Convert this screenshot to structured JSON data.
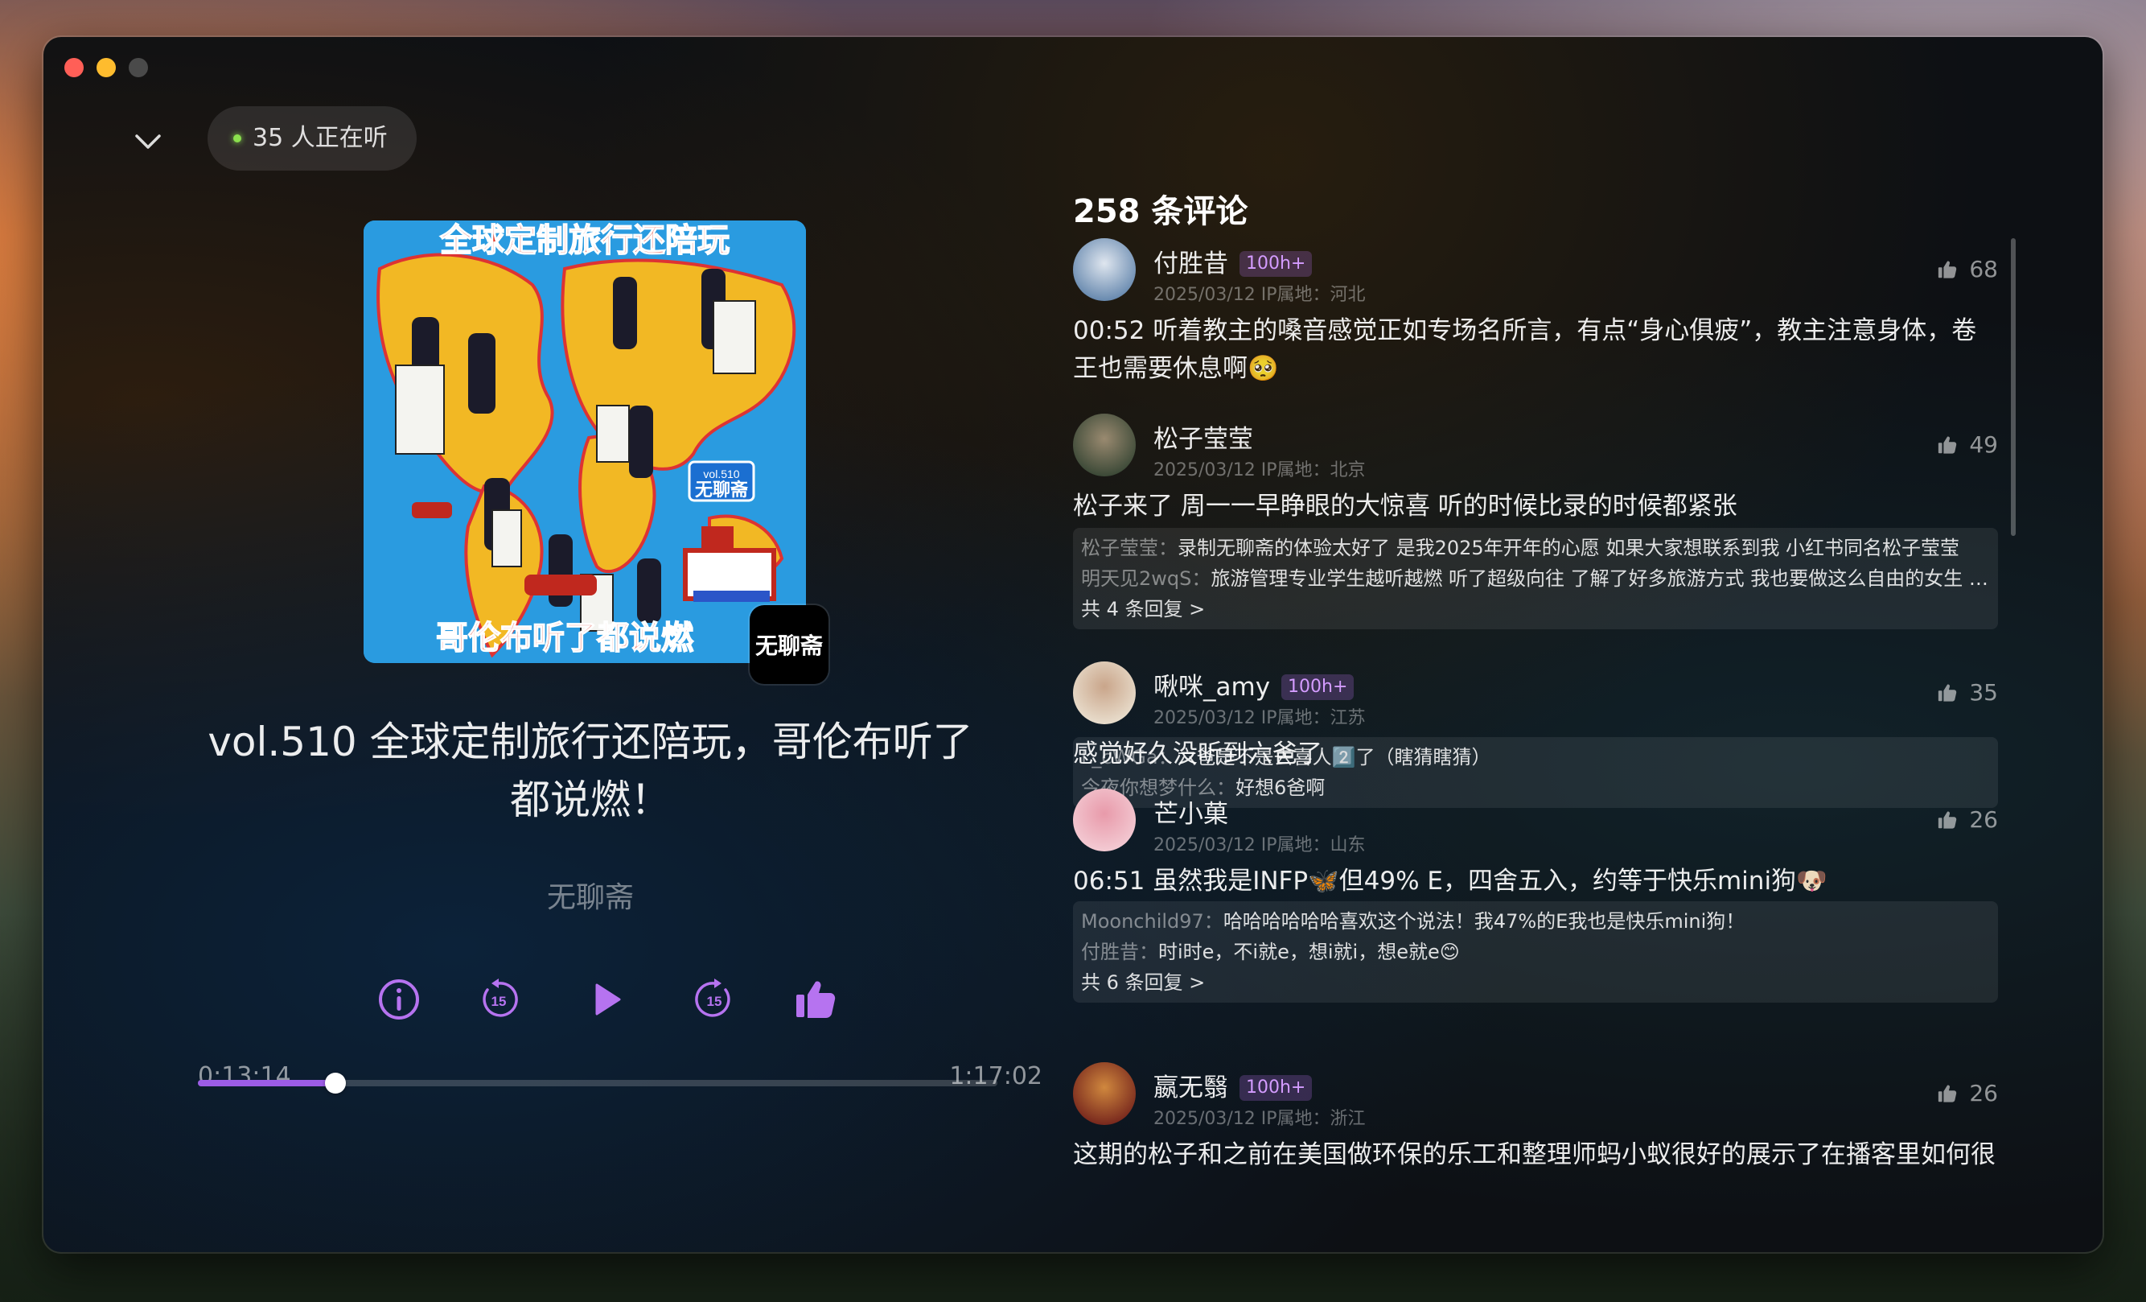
{
  "window": {
    "controls": [
      "close",
      "minimize",
      "maximize"
    ]
  },
  "header": {
    "collapse_icon": "chevron-down-icon",
    "listeners_text": "35 人正在听",
    "live_color": "#8be04e"
  },
  "cover": {
    "headline_top": "全球定制旅行还陪玩",
    "headline_bottom": "哥伦布听了都说燃",
    "volume_tag": "vol.510",
    "show_logo_text": "无聊斋",
    "badge_text": "无聊斋"
  },
  "episode": {
    "title": "vol.510 全球定制旅行还陪玩，哥伦布听了都说燃！",
    "author": "无聊斋"
  },
  "player": {
    "buttons": [
      "info-icon",
      "rewind-15-icon",
      "play-icon",
      "forward-15-icon",
      "thumbs-up-icon"
    ],
    "rewind_seconds": "15",
    "forward_seconds": "15",
    "current_time": "0:13:14",
    "total_time": "1:17:02",
    "progress": 0.1718,
    "accent": "#9c5ce6"
  },
  "comments": {
    "title": "258 条评论",
    "items": [
      {
        "name": "付胜昔",
        "badge": "100h+",
        "meta": "2025/03/12 IP属地：河北",
        "likes": "68",
        "text": "00:52 听着教主的嗓音感觉正如专场名所言，有点“身心俱疲”，教主注意身体，卷王也需要休息啊🥺",
        "replies": [],
        "more": ""
      },
      {
        "name": "松子莹莹",
        "badge": "",
        "meta": "2025/03/12 IP属地：北京",
        "likes": "49",
        "text": "松子来了 周一一早睁眼的大惊喜 听的时候比录的时候都紧张",
        "replies": [
          {
            "user": "松子莹莹：",
            "text": "录制无聊斋的体验太好了 是我2025年开年的心愿 如果大家想联系到我 小红书同名松子莹莹"
          },
          {
            "user": "明天见2wqS：",
            "text": "旅游管理专业学生越听越燃 听了超级向往 了解了好多旅游方式 我也要做这么自由的女生 想要做这样的工作！"
          }
        ],
        "more": "共 4 条回复 >"
      },
      {
        "name": "啾咪_amy",
        "badge": "100h+",
        "meta": "2025/03/12 IP属地：江苏",
        "likes": "35",
        "text": "感觉好久没听到六爸了",
        "replies": [
          {
            "user": "L_cWGa：",
            "text": "六爸是不是去喜人2️⃣了（瞎猜瞎猜）"
          },
          {
            "user": "今夜你想梦什么：",
            "text": "好想6爸啊"
          }
        ],
        "more": ""
      },
      {
        "name": "芒小菓",
        "badge": "",
        "meta": "2025/03/12 IP属地：山东",
        "likes": "26",
        "text": "06:51 虽然我是INFP🦋但49% E，四舍五入，约等于快乐mini狗🐶",
        "replies": [
          {
            "user": "Moonchild97：",
            "text": "哈哈哈哈哈哈喜欢这个说法！我47%的E我也是快乐mini狗！"
          },
          {
            "user": "付胜昔：",
            "text": "时i时e，不i就e，想i就i，想e就e😊"
          }
        ],
        "more": "共 6 条回复 >"
      },
      {
        "name": "嬴无翳",
        "badge": "100h+",
        "meta": "2025/03/12 IP属地：浙江",
        "likes": "26",
        "text": "这期的松子和之前在美国做环保的乐工和整理师蚂小蚁很好的展示了在播客里如何很",
        "replies": [],
        "more": ""
      }
    ]
  }
}
